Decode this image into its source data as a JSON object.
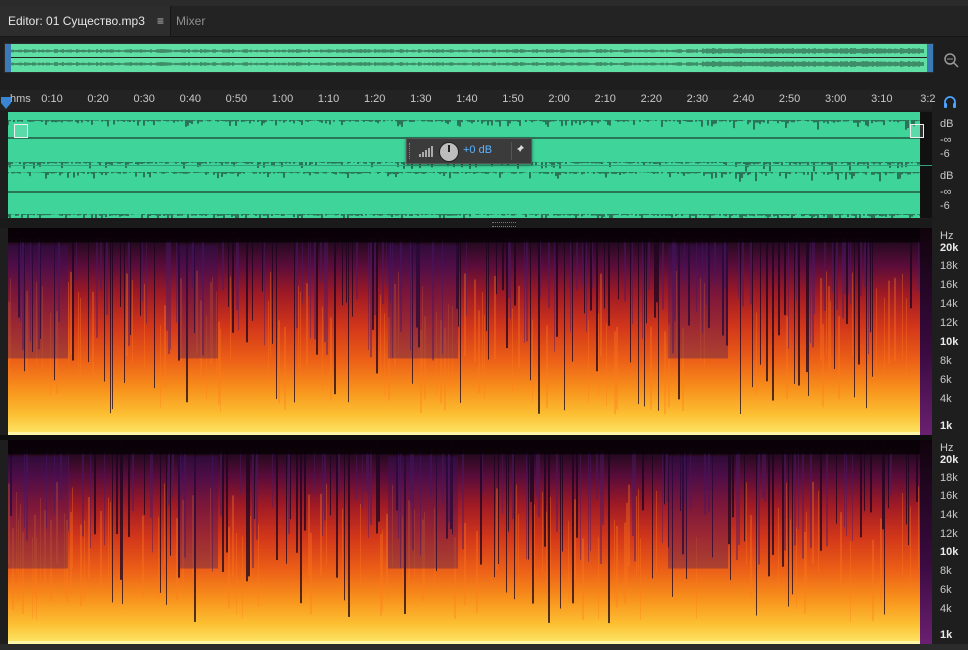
{
  "tabs": [
    {
      "label": "Editor: 01 Существо.mp3",
      "active": true,
      "menu_glyph": "≡"
    },
    {
      "label": "Mixer",
      "active": false
    }
  ],
  "ruler": {
    "unit": "hms",
    "ticks": [
      "0:10",
      "0:20",
      "0:30",
      "0:40",
      "0:50",
      "1:00",
      "1:10",
      "1:20",
      "1:30",
      "1:40",
      "1:50",
      "2:00",
      "2:10",
      "2:20",
      "2:30",
      "2:40",
      "2:50",
      "3:00",
      "3:10",
      "3:2"
    ]
  },
  "amplitude_hud": {
    "value": "+0 dB"
  },
  "waveform_scale": {
    "ch1": {
      "unit": "dB",
      "labels": [
        "-∞",
        "-6"
      ]
    },
    "ch2": {
      "unit": "dB",
      "labels": [
        "-∞",
        "-6"
      ]
    }
  },
  "spectral_scale": {
    "unit": "Hz",
    "labels": [
      "20k",
      "18k",
      "16k",
      "14k",
      "12k",
      "10k",
      "8k",
      "6k",
      "4k",
      "1k"
    ],
    "bold": [
      "20k",
      "10k",
      "1k"
    ]
  },
  "colors": {
    "waveform": "#3fd59a",
    "overview": "#5fdfa3",
    "accent": "#3a7bb5",
    "hud_value": "#5ab4ff"
  },
  "icons": {
    "zoom": "zoom-navigator-icon",
    "monitor": "headphone-icon",
    "pin": "pin-icon"
  }
}
